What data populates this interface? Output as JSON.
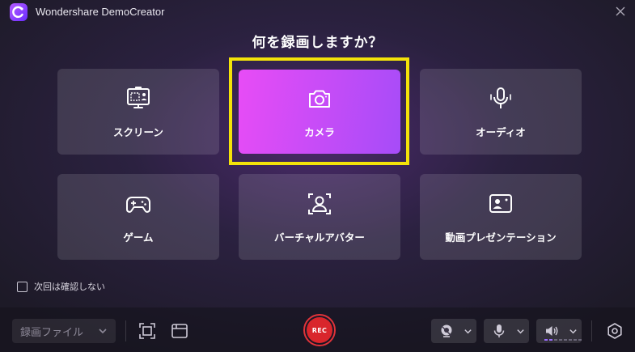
{
  "window": {
    "title": "Wondershare DemoCreator"
  },
  "heading": "何を録画しますか？",
  "modes": [
    {
      "label": "スクリーン",
      "icon": "screen-record-icon"
    },
    {
      "label": "カメラ",
      "icon": "camera-icon",
      "selected": true
    },
    {
      "label": "オーディオ",
      "icon": "microphone-icon"
    },
    {
      "label": "ゲーム",
      "icon": "gamepad-icon"
    },
    {
      "label": "バーチャルアバター",
      "icon": "avatar-icon"
    },
    {
      "label": "動画プレゼンテーション",
      "icon": "presentation-icon"
    }
  ],
  "options": {
    "dont_ask_label": "次回は確認しない",
    "dont_ask_checked": false
  },
  "toolbar": {
    "file_select_value": "録画ファイル",
    "rec_label": "REC",
    "audio_level": 0.6
  },
  "colors": {
    "accent_gradient_start": "#e84cf6",
    "accent_gradient_end": "#a64cf8",
    "highlight_frame": "#f4e309",
    "rec_red": "#d9262c"
  }
}
